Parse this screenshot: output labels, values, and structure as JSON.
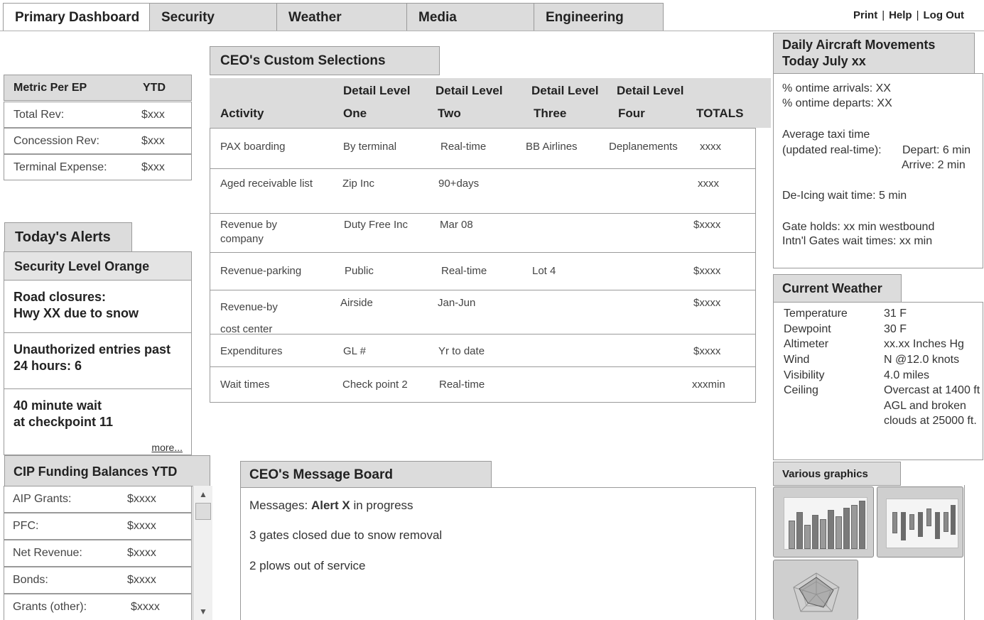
{
  "tabs": [
    {
      "label": "Primary Dashboard",
      "active": true
    },
    {
      "label": "Security"
    },
    {
      "label": "Weather"
    },
    {
      "label": "Media"
    },
    {
      "label": "Engineering"
    }
  ],
  "toplinks": {
    "print": "Print",
    "help": "Help",
    "logout": "Log Out",
    "sep": "|"
  },
  "metrics": {
    "header": {
      "metric": "Metric Per EP",
      "ytd": "YTD"
    },
    "rows": [
      {
        "label": "Total Rev:",
        "value": "$xxx"
      },
      {
        "label": "Concession Rev:",
        "value": "$xxx"
      },
      {
        "label": "Terminal Expense:",
        "value": "$xxx"
      }
    ]
  },
  "alerts": {
    "title": "Today's Alerts",
    "level": "Security Level Orange",
    "items": [
      {
        "line1": "Road closures:",
        "line2": "Hwy XX due to snow"
      },
      {
        "line1": "Unauthorized entries past",
        "line2": "24 hours: 6"
      },
      {
        "line1": "40 minute wait",
        "line2": "at checkpoint 11"
      }
    ],
    "more": "more..."
  },
  "cip": {
    "title": "CIP Funding  Balances YTD",
    "rows": [
      {
        "label": "AIP Grants:",
        "value": "$xxxx"
      },
      {
        "label": "PFC:",
        "value": "$xxxx"
      },
      {
        "label": "Net Revenue:",
        "value": "$xxxx"
      },
      {
        "label": "Bonds:",
        "value": "$xxxx"
      },
      {
        "label": "Grants (other):",
        "value": "$xxxx"
      }
    ]
  },
  "ceo": {
    "title": "CEO's Custom Selections",
    "headers": {
      "activity": "Activity",
      "d1a": "Detail Level",
      "d1b": "One",
      "d2a": "Detail Level",
      "d2b": "Two",
      "d3a": "Detail Level",
      "d3b": "Three",
      "d4a": "Detail Level",
      "d4b": "Four",
      "totals": "TOTALS"
    },
    "rows": [
      {
        "activity": "PAX boarding",
        "d1": "By terminal",
        "d2": "Real-time",
        "d3": "BB Airlines",
        "d4": "Deplanements",
        "total": "xxxx"
      },
      {
        "activity": "Aged receivable list",
        "d1": "Zip Inc",
        "d2": "90+days",
        "d3": "",
        "d4": "",
        "total": "xxxx"
      },
      {
        "activity": "Revenue by company",
        "d1": "Duty Free Inc",
        "d2": "Mar 08",
        "d3": "",
        "d4": "",
        "total": "$xxxx"
      },
      {
        "activity": "Revenue-parking",
        "d1": "Public",
        "d2": "Real-time",
        "d3": "Lot 4",
        "d4": "",
        "total": "$xxxx"
      },
      {
        "activity": "Revenue-by cost center",
        "d1": "Airside",
        "d2": "Jan-Jun",
        "d3": "",
        "d4": "",
        "total": "$xxxx"
      },
      {
        "activity": "Expenditures",
        "d1": "GL #",
        "d2": "Yr to date",
        "d3": "",
        "d4": "",
        "total": "$xxxx"
      },
      {
        "activity": "Wait times",
        "d1": "Check point 2",
        "d2": "Real-time",
        "d3": "",
        "d4": "",
        "total": "xxxmin"
      }
    ]
  },
  "messages": {
    "title": "CEO's Message Board",
    "prefix": "Messages: ",
    "alert": "Alert X",
    "suffix": " in progress",
    "lines": [
      "3 gates closed due to snow removal",
      "2 plows out of service"
    ]
  },
  "aircraft": {
    "title1": "Daily Aircraft Movements",
    "title2": "Today July xx",
    "ontime_arrivals": "% ontime arrivals: XX",
    "ontime_departs": "% ontime departs: XX",
    "taxi_label1": "Average taxi  time",
    "taxi_label2": "(updated real-time):",
    "depart": "Depart: 6 min",
    "arrive": "Arrive:  2 min",
    "deicing": "De-Icing wait time:  5 min",
    "gateholds": "Gate holds:  xx min westbound",
    "intl": "Intn'l Gates wait times:  xx min"
  },
  "weather": {
    "title": "Current Weather",
    "rows": [
      {
        "label": "Temperature",
        "value": "31  F"
      },
      {
        "label": "Dewpoint",
        "value": "30 F"
      },
      {
        "label": "Altimeter",
        "value": "xx.xx Inches Hg"
      },
      {
        "label": "Wind",
        "value": "N @12.0 knots"
      },
      {
        "label": "Visibility",
        "value": "4.0 miles"
      },
      {
        "label": "Ceiling",
        "value": "Overcast at 1400 ft AGL and broken clouds at 25000 ft."
      }
    ]
  },
  "graphics": {
    "title": "Various graphics"
  },
  "colors": {
    "header_gray": "#dcdcdc",
    "border": "#9a9a9a"
  }
}
